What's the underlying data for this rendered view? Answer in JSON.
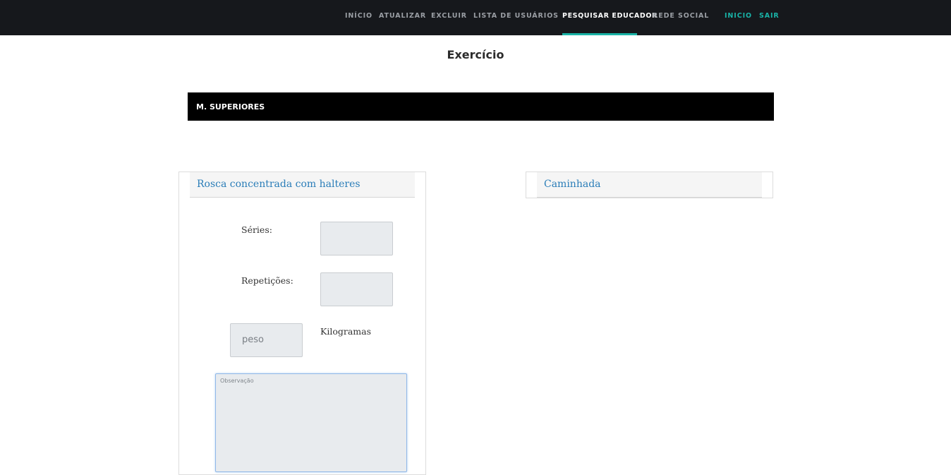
{
  "nav": {
    "items": [
      {
        "label": "Início"
      },
      {
        "label": "Atualizar"
      },
      {
        "label": "Excluir"
      },
      {
        "label": "Lista de Usuários"
      },
      {
        "label": "Pesquisar Educador"
      },
      {
        "label": "Rede Social"
      }
    ],
    "right": [
      {
        "label": "Inicio"
      },
      {
        "label": "Sair"
      }
    ],
    "active_index": 4,
    "accent_color": "#1ab3a6"
  },
  "page": {
    "title": "Exercício"
  },
  "section": {
    "label": "M. SUPERIORES"
  },
  "cards": [
    {
      "title": "Rosca concentrada com halteres",
      "series_label": "Séries:",
      "series_value": "",
      "reps_label": "Repetições:",
      "reps_value": "",
      "weight_placeholder": "peso",
      "weight_unit": "Kilogramas",
      "notes_placeholder": "Observação"
    },
    {
      "title": "Caminhada"
    }
  ]
}
